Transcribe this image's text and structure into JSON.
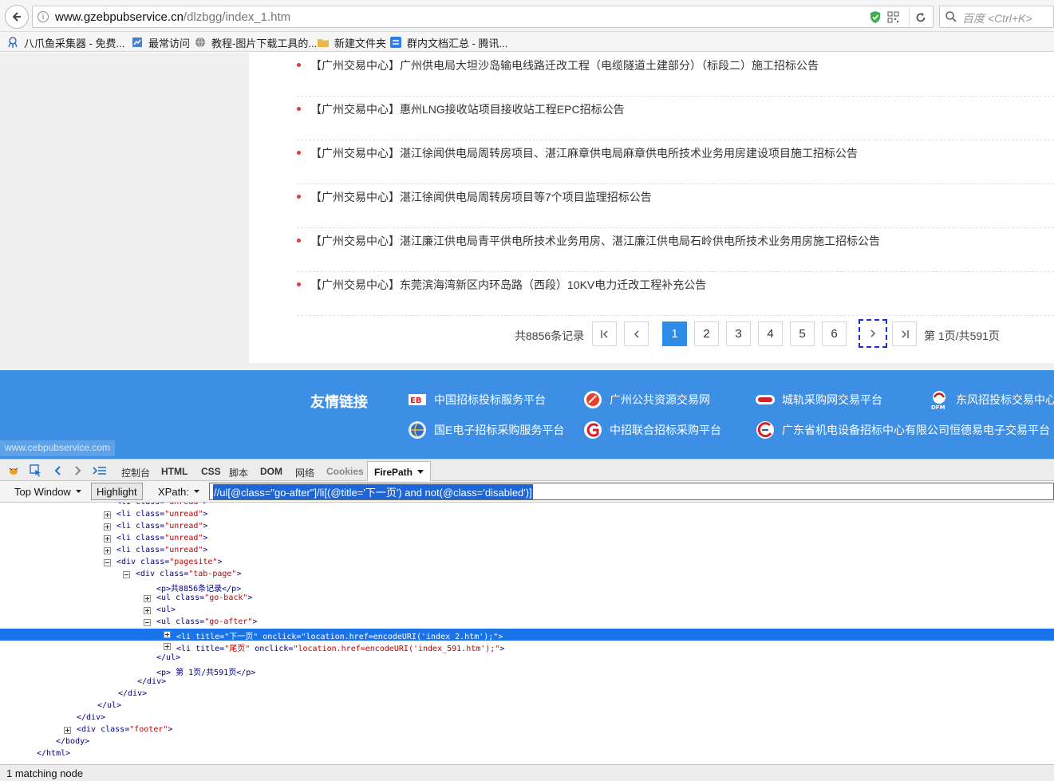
{
  "browser": {
    "url_host": "www.gzebpubservice.cn",
    "url_path": "/dlzbgg/index_1.htm",
    "search_placeholder": "百度 <Ctrl+K>",
    "bookmarks": [
      {
        "label": "八爪鱼采集器 - 免费..."
      },
      {
        "label": "最常访问"
      },
      {
        "label": "教程-图片下载工具的..."
      },
      {
        "label": "新建文件夹"
      },
      {
        "label": "群内文档汇总 - 腾讯..."
      }
    ]
  },
  "news": [
    {
      "title": "【广州交易中心】广州供电局大坦沙岛输电线路迁改工程（电缆隧道土建部分）（标段二）施工招标公告"
    },
    {
      "title": "【广州交易中心】惠州LNG接收站项目接收站工程EPC招标公告"
    },
    {
      "title": "【广州交易中心】湛江徐闻供电局周转房项目、湛江麻章供电局麻章供电所技术业务用房建设项目施工招标公告"
    },
    {
      "title": "【广州交易中心】湛江徐闻供电局周转房项目等7个项目监理招标公告"
    },
    {
      "title": "【广州交易中心】湛江廉江供电局青平供电所技术业务用房、湛江廉江供电局石岭供电所技术业务用房施工招标公告"
    },
    {
      "title": "【广州交易中心】东莞滨海湾新区内环岛路（西段）10KV电力迁改工程补充公告"
    }
  ],
  "pager": {
    "total": "共8856条记录",
    "first": "⇤",
    "prev": "‹",
    "pages": [
      "1",
      "2",
      "3",
      "4",
      "5",
      "6"
    ],
    "next": "›",
    "last": "⇥",
    "info": "第 1页/共591页"
  },
  "footer": {
    "title": "友情链接",
    "links": [
      {
        "label": "中国招标投标服务平台"
      },
      {
        "label": "广州公共资源交易网"
      },
      {
        "label": "城轨采购网交易平台"
      },
      {
        "label": "东风招投标交易中心"
      },
      {
        "label": "国E电子招标采购服务平台"
      },
      {
        "label": "中招联合招标采购平台"
      },
      {
        "label": "广东省机电设备招标中心有限公司恒德易电子交易平台"
      }
    ],
    "status_url": "www.cebpubservice.com"
  },
  "devtools": {
    "tabs": [
      "控制台",
      "HTML",
      "CSS",
      "脚本",
      "DOM",
      "网络",
      "Cookies"
    ],
    "active_tab": "FirePath",
    "window_select": "Top Window",
    "highlight": "Highlight",
    "xpath_label": "XPath:",
    "xpath_value": "//ul[@class=\"go-after\"]/li[(@title='下一页') and not(@class='disabled')]",
    "status": "1 matching node"
  },
  "dom_tree": [
    {
      "tw": "",
      "html": "<li  class=\"unread\">"
    },
    {
      "tw": "plus",
      "html": "<li  class=\"unread\">"
    },
    {
      "tw": "plus",
      "html": "<li  class=\"unread\">"
    },
    {
      "tw": "plus",
      "html": "<li  class=\"unread\">"
    },
    {
      "tw": "plus",
      "html": "<li  class=\"unread\">"
    },
    {
      "tw": "minus",
      "html": "<div  class=\"pagesite\">"
    },
    {
      "tw": "minus",
      "html": "<div  class=\"tab-page\">"
    },
    {
      "tw": "",
      "html": "<p>共8856条记录</p>"
    },
    {
      "tw": "plus",
      "html": "<ul  class=\"go-back\">"
    },
    {
      "tw": "plus",
      "html": "<ul>"
    },
    {
      "tw": "minus",
      "html": "<ul  class=\"go-after\">"
    },
    {
      "tw": "plus",
      "html": "<li  title=\"下一页\"  onclick=\"location.href=encodeURI('index_2.htm');\">"
    },
    {
      "tw": "plus",
      "html": "<li  title=\"尾页\"  onclick=\"location.href=encodeURI('index_591.htm');\">"
    },
    {
      "tw": "",
      "html": "</ul>"
    },
    {
      "tw": "",
      "html": "<p>  第 1页/共591页</p>"
    },
    {
      "tw": "",
      "html": "</div>"
    },
    {
      "tw": "",
      "html": "</div>"
    },
    {
      "tw": "",
      "html": "</ul>"
    },
    {
      "tw": "",
      "html": "</div>"
    },
    {
      "tw": "plus",
      "html": "<div  class=\"footer\">"
    },
    {
      "tw": "",
      "html": "</body>"
    },
    {
      "tw": "",
      "html": "</html>"
    }
  ],
  "colors": {
    "accent": "#2d8ce8",
    "footer_band": "#3d8fe6",
    "bullet": "#e23b3b",
    "selection": "#1a73e8"
  }
}
